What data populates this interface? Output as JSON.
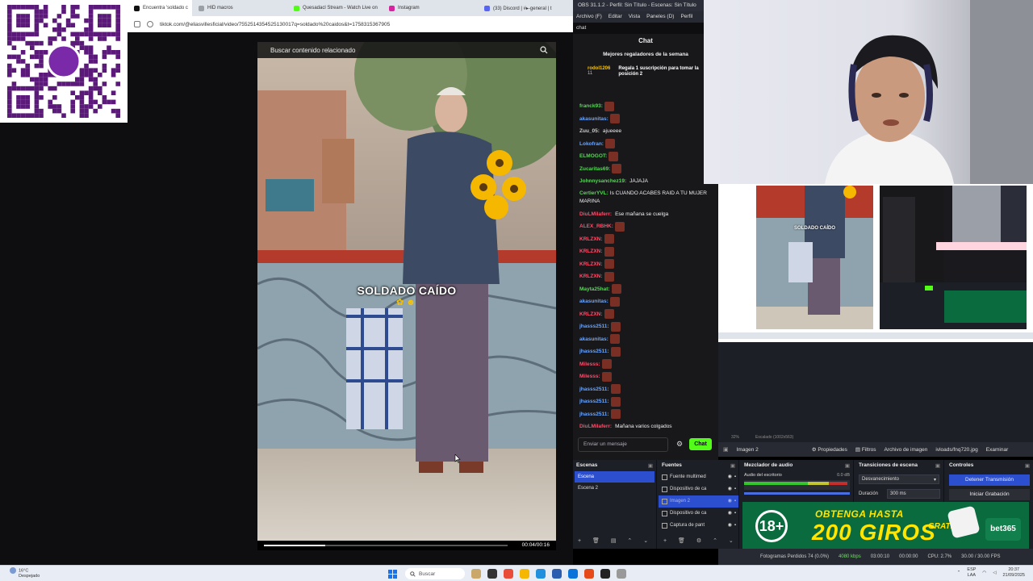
{
  "browser": {
    "tabs": [
      {
        "label": "Encuentra 'soldado c",
        "color": "#111111",
        "active": true
      },
      {
        "label": "HID macros",
        "color": "#9aa0a6",
        "active": false
      },
      {
        "label": "Quesadacl Stream - Watch Live on",
        "color": "#53fc18",
        "active": false
      },
      {
        "label": "Instagram",
        "color": "#d6249f",
        "active": false
      },
      {
        "label": "(33) Discord | #▸-general | t",
        "color": "#5865f2",
        "active": false
      }
    ],
    "url": "tiktok.com/@eliasvillesficial/video/7552514354525130017q=soldado%20caidos&t=1758315367905"
  },
  "video": {
    "search_placeholder": "Buscar contenido relacionado",
    "caption": "SOLDADO CAÍDO",
    "time": "00:04/00:16",
    "progress": 0.25
  },
  "chat": {
    "tab_label": "chat",
    "title": "Chat",
    "leaderboard_title": "Mejores regaladores de la semana",
    "leader_user": "rodol1206",
    "leader_count": "11",
    "leader_cta": "Regala 1 suscripción para tomar la posición 2",
    "messages": [
      {
        "user": "franck93:",
        "text": "",
        "color": "#57d657",
        "emote": true
      },
      {
        "user": "akasunitas:",
        "text": "",
        "color": "#6aa5ff",
        "emote": true
      },
      {
        "user": "Zuu_05:",
        "text": "ajueeee",
        "color": "#cfcfcf",
        "emote": false
      },
      {
        "user": "Lokofran:",
        "text": "",
        "color": "#6aa5ff",
        "emote": true
      },
      {
        "user": "ELMOGOT:",
        "text": "",
        "color": "#57d657",
        "emote": true
      },
      {
        "user": "Zucaritas69:",
        "text": "",
        "color": "#57d657",
        "emote": true
      },
      {
        "user": "Johnnysanchez19:",
        "text": "JAJAJA",
        "color": "#57d657",
        "emote": false
      },
      {
        "user": "CertierYVL:",
        "text": "Is CUANDO ACABES RAID A TU MUJER MARINA",
        "color": "#57d657",
        "emote": false,
        "wrap": true
      },
      {
        "user": "DiuLMilaferr:",
        "text": "Ese mañana se cuelga",
        "color": "#ff4d6a",
        "emote": false
      },
      {
        "user": "ALEX_RBHK:",
        "text": "",
        "color": "#ff4d6a",
        "emote": true
      },
      {
        "user": "KRLZXN:",
        "text": "",
        "color": "#ff4d6a",
        "emote": true
      },
      {
        "user": "KRLZXN:",
        "text": "",
        "color": "#ff4d6a",
        "emote": true
      },
      {
        "user": "KRLZXN:",
        "text": "",
        "color": "#ff4d6a",
        "emote": true
      },
      {
        "user": "KRLZXN:",
        "text": "",
        "color": "#ff4d6a",
        "emote": true
      },
      {
        "user": "Mayta25hat:",
        "text": "",
        "color": "#57d657",
        "emote": true
      },
      {
        "user": "akasunitas:",
        "text": "",
        "color": "#6aa5ff",
        "emote": true
      },
      {
        "user": "KRLZXN:",
        "text": "",
        "color": "#ff4d6a",
        "emote": true
      },
      {
        "user": "jhasss2511:",
        "text": "",
        "color": "#6aa5ff",
        "emote": true
      },
      {
        "user": "akasunitas:",
        "text": "",
        "color": "#6aa5ff",
        "emote": true
      },
      {
        "user": "jhasss2511:",
        "text": "",
        "color": "#6aa5ff",
        "emote": true
      },
      {
        "user": "Milesss:",
        "text": "",
        "color": "#ff4d6a",
        "emote": true
      },
      {
        "user": "Milesss:",
        "text": "",
        "color": "#ff4d6a",
        "emote": true
      },
      {
        "user": "jhasss2511:",
        "text": "",
        "color": "#6aa5ff",
        "emote": true
      },
      {
        "user": "jhasss2511:",
        "text": "",
        "color": "#6aa5ff",
        "emote": true
      },
      {
        "user": "jhasss2511:",
        "text": "",
        "color": "#6aa5ff",
        "emote": true
      },
      {
        "user": "DiuLMilaferr:",
        "text": "Mañana varios colgados",
        "color": "#ff4d6a",
        "emote": false
      }
    ],
    "input_placeholder": "Enviar un mensaje",
    "send_label": "Chat"
  },
  "obs": {
    "title": "OBS 31.1.2 - Perfil: Sin Título - Escenas: Sin Título",
    "menu": [
      "Archivo (F)",
      "Editar",
      "Vista",
      "Paneles (D)",
      "Perfil"
    ],
    "preview_caption": "SOLDADO CAÍDO",
    "status_zoom": "32%",
    "status_scale": "Escalado (1002x563)",
    "toolbar": {
      "source_name": "Imagen 2",
      "properties": "Propiedades",
      "filters": "Filtros",
      "image_file": "Archivo de imagen",
      "file_path": "ivloads/fnq720.jpg",
      "browse": "Examinar"
    },
    "docks": {
      "scenes_title": "Escenas",
      "scenes": [
        "Escena",
        "Escena 2"
      ],
      "sources_title": "Fuentes",
      "sources": [
        {
          "label": "Fuente multimed",
          "sel": false
        },
        {
          "label": "Dispositivo de ca",
          "sel": false
        },
        {
          "label": "Imagen 2",
          "sel": true
        },
        {
          "label": "Dispositivo de ca",
          "sel": false
        },
        {
          "label": "Captura de pant",
          "sel": false
        }
      ],
      "mixer_title": "Mezclador de audio",
      "mixer_channel": "Audio del escritorio",
      "mixer_db": "0.0 dB",
      "transitions_title": "Transiciones de escena",
      "transition_type": "Desvanecimiento",
      "duration_label": "Duración",
      "duration_value": "300 ms",
      "controls_title": "Controles",
      "stop_stream": "Detener Transmisión",
      "start_recording": "Iniciar Grabación"
    },
    "statusbar": {
      "frames": "Fotogramas Perdidos 74 (0.0%)",
      "bitrate": "4080 kbps",
      "live_time": "03:00:10",
      "rec_time": "00:00:00",
      "cpu": "CPU: 2.7%",
      "fps": "30.00 / 30.00 FPS"
    }
  },
  "ad": {
    "age": "18+",
    "line1": "OBTENGA HASTA",
    "line2": "200 GIROS",
    "line3": "GRATIS",
    "brand": "bet365"
  },
  "taskbar": {
    "weather_temp": "16°C",
    "weather_desc": "Despejado",
    "search_label": "Buscar",
    "lang": "ESP",
    "lang2": "LAA",
    "time": "20:37",
    "date": "21/09/2025"
  },
  "colors": {
    "obs_selection": "#2c4fcf",
    "kick_green": "#53fc18",
    "ad_green": "#0a6b3e",
    "ad_yellow": "#ffe500"
  }
}
